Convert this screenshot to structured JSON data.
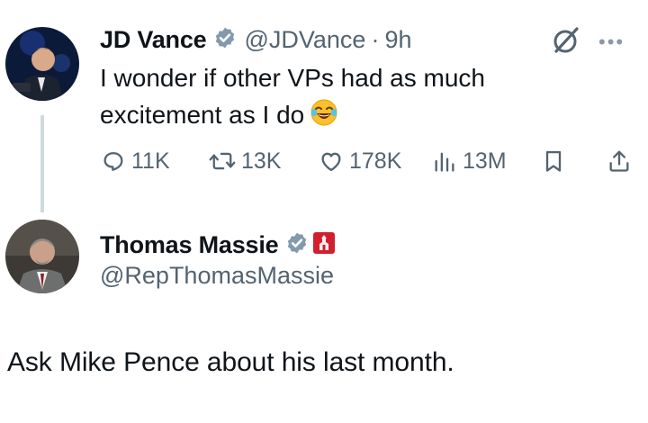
{
  "tweet": {
    "author_name": "JD Vance",
    "handle": "@JDVance",
    "time": "9h",
    "text": "I wonder if other VPs had as much excitement as I do",
    "stats": {
      "replies": "11K",
      "reposts": "13K",
      "likes": "178K",
      "views": "13M"
    }
  },
  "reply": {
    "author_name": "Thomas Massie",
    "handle": "@RepThomasMassie",
    "text": "Ask Mike Pence about his last month."
  },
  "icons": [
    "verified-badge-icon",
    "grok-icon",
    "more-icon",
    "reply-icon",
    "repost-icon",
    "like-icon",
    "views-icon",
    "bookmark-icon",
    "share-icon",
    "government-badge-icon",
    "laughing-emoji-icon"
  ],
  "colors": {
    "secondary_text": "#536471",
    "verified_gray": "#829aab",
    "gov_badge_red": "#d0202e"
  }
}
